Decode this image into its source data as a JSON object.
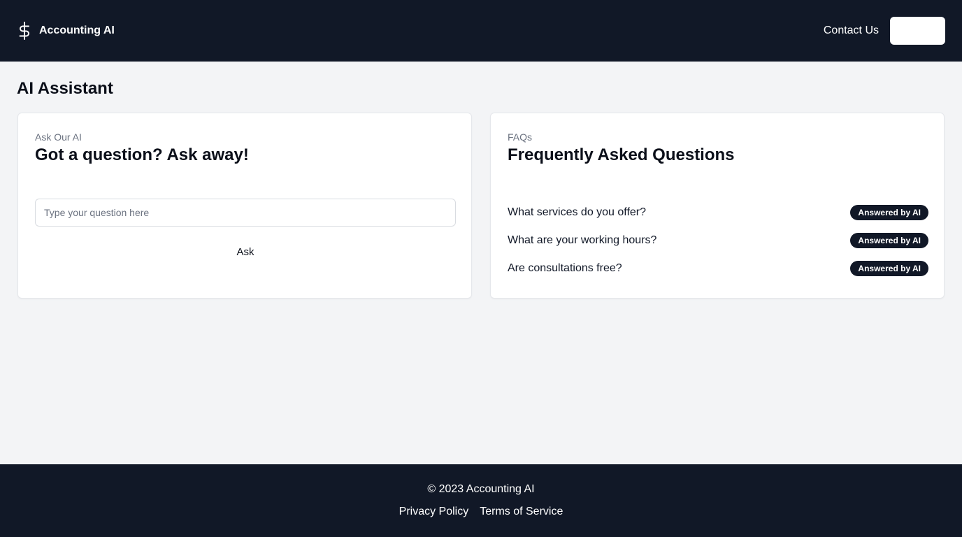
{
  "header": {
    "brand_name": "Accounting AI",
    "brand_icon": "dollar-icon",
    "contact_link": "Contact Us",
    "action_button_label": ""
  },
  "page": {
    "title": "AI Assistant"
  },
  "ask_card": {
    "eyebrow": "Ask Our AI",
    "title": "Got a question? Ask away!",
    "input_placeholder": "Type your question here",
    "input_value": "",
    "ask_label": "Ask"
  },
  "faq_card": {
    "eyebrow": "FAQs",
    "title": "Frequently Asked Questions",
    "items": [
      {
        "question": "What services do you offer?",
        "badge": "Answered by AI"
      },
      {
        "question": "What are your working hours?",
        "badge": "Answered by AI"
      },
      {
        "question": "Are consultations free?",
        "badge": "Answered by AI"
      }
    ]
  },
  "footer": {
    "copyright": "© 2023 Accounting AI",
    "privacy_link": "Privacy Policy",
    "terms_link": "Terms of Service"
  },
  "colors": {
    "header_bg": "#111827",
    "page_bg": "#f3f4f6",
    "card_bg": "#ffffff",
    "badge_bg": "#111827"
  }
}
